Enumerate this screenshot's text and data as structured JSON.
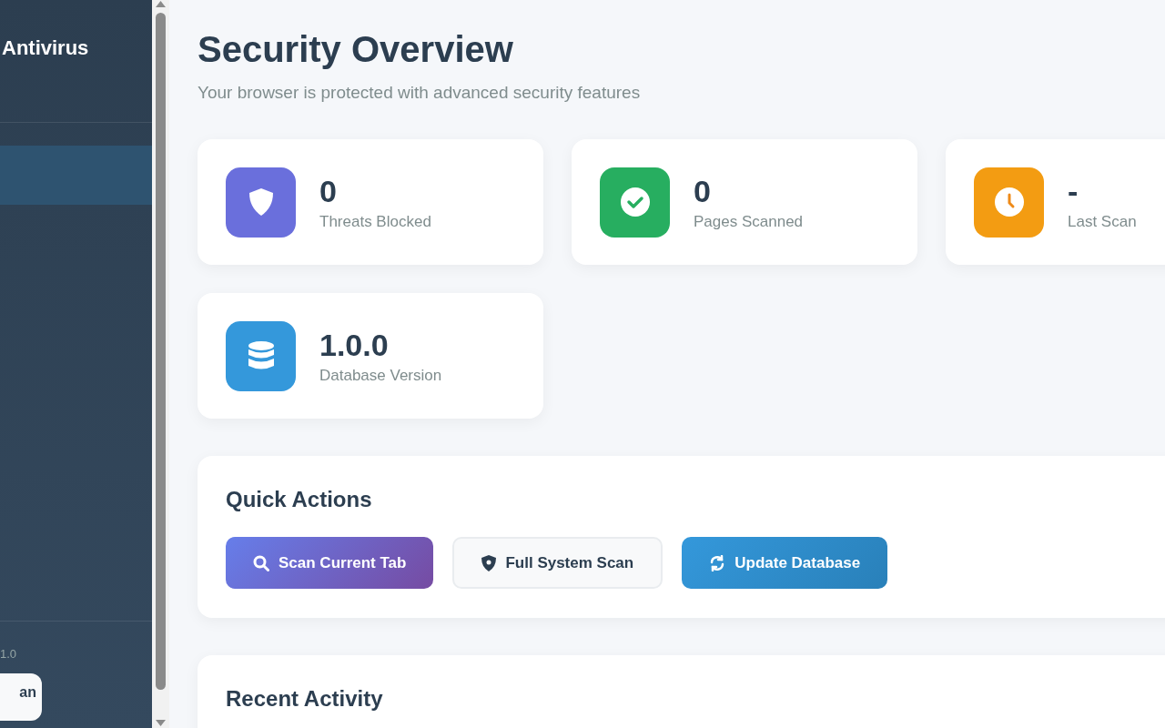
{
  "sidebar": {
    "title": "Antivirus",
    "nav_items": [
      {
        "selected": true
      }
    ],
    "version": "1.0",
    "footer_button": "an"
  },
  "header": {
    "title": "Security Overview",
    "subtitle": "Your browser is protected with advanced security features"
  },
  "stats": [
    {
      "value": "0",
      "label": "Threats Blocked",
      "color": "#6a6fdc"
    },
    {
      "value": "0",
      "label": "Pages Scanned",
      "color": "#27ae60"
    },
    {
      "value": "-",
      "label": "Last Scan",
      "color": "#f39c12"
    },
    {
      "value": "1.0.0",
      "label": "Database Version",
      "color": "#3498db"
    }
  ],
  "quick_actions": {
    "title": "Quick Actions",
    "buttons": [
      {
        "label": "Scan Current Tab",
        "kind": "primary"
      },
      {
        "label": "Full System Scan",
        "kind": "secondary"
      },
      {
        "label": "Update Database",
        "kind": "info"
      }
    ]
  },
  "recent_activity": {
    "title": "Recent Activity"
  }
}
